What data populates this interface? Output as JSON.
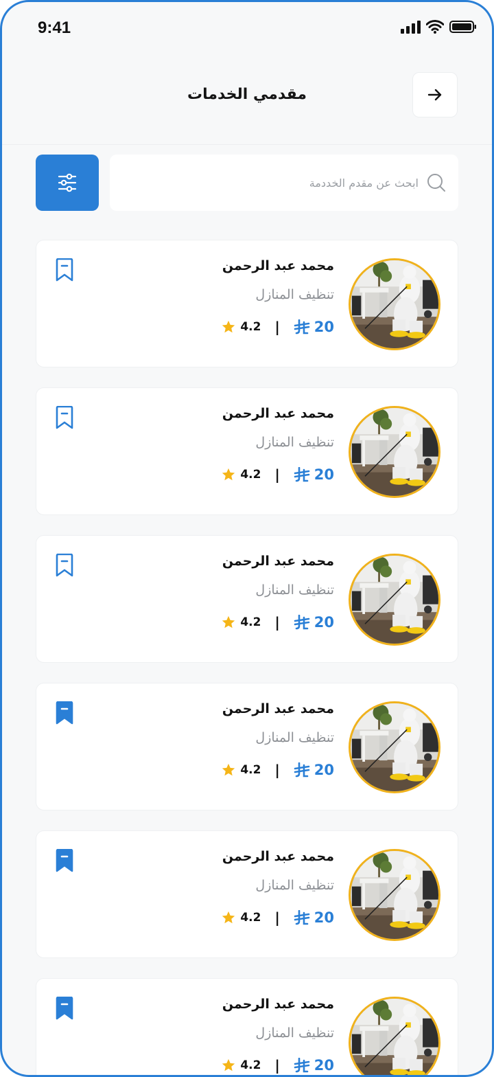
{
  "status_bar": {
    "time": "9:41"
  },
  "header": {
    "title": "مقدمي الخدمات"
  },
  "search": {
    "placeholder": "ابحث عن مقدم الخددمة"
  },
  "colors": {
    "accent": "#2a7fd6",
    "star": "#f5b518",
    "avatar_ring": "#f0b21c"
  },
  "providers": [
    {
      "name": "محمد عبد الرحمن",
      "service": "تنظيف المنازل",
      "price": "20",
      "rating": "4.2",
      "saved": false
    },
    {
      "name": "محمد عبد الرحمن",
      "service": "تنظيف المنازل",
      "price": "20",
      "rating": "4.2",
      "saved": false
    },
    {
      "name": "محمد عبد الرحمن",
      "service": "تنظيف المنازل",
      "price": "20",
      "rating": "4.2",
      "saved": false
    },
    {
      "name": "محمد عبد الرحمن",
      "service": "تنظيف المنازل",
      "price": "20",
      "rating": "4.2",
      "saved": true
    },
    {
      "name": "محمد عبد الرحمن",
      "service": "تنظيف المنازل",
      "price": "20",
      "rating": "4.2",
      "saved": true
    },
    {
      "name": "محمد عبد الرحمن",
      "service": "تنظيف المنازل",
      "price": "20",
      "rating": "4.2",
      "saved": true
    }
  ]
}
